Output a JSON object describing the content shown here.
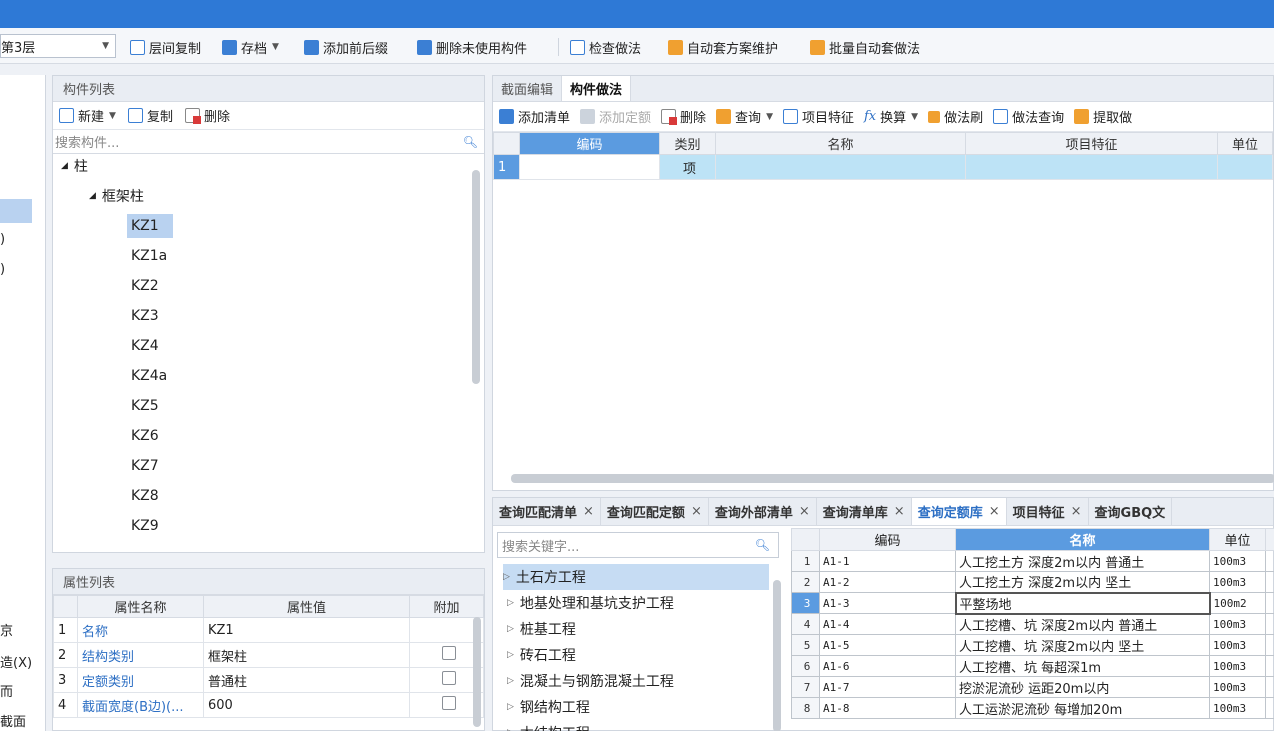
{
  "toolbar": {
    "floor": "第3层",
    "items": [
      "层间复制",
      "存档",
      "添加前后缀",
      "删除未使用构件",
      "检查做法",
      "自动套方案维护",
      "批量自动套做法"
    ]
  },
  "left_strip": {
    "labels": [
      ")",
      ")",
      "京",
      "造(X)",
      "而",
      "截面"
    ]
  },
  "component_list": {
    "title": "构件列表",
    "tools": [
      "新建",
      "复制",
      "删除"
    ],
    "search_placeholder": "搜索构件...",
    "tree": {
      "root": "柱",
      "group": "框架柱",
      "items": [
        "KZ1",
        "KZ1a",
        "KZ2",
        "KZ3",
        "KZ4",
        "KZ4a",
        "KZ5",
        "KZ6",
        "KZ7",
        "KZ8",
        "KZ9"
      ]
    }
  },
  "property_list": {
    "title": "属性列表",
    "headers": [
      "属性名称",
      "属性值",
      "附加"
    ],
    "rows": [
      {
        "num": "1",
        "name": "名称",
        "value": "KZ1"
      },
      {
        "num": "2",
        "name": "结构类别",
        "value": "框架柱"
      },
      {
        "num": "3",
        "name": "定额类别",
        "value": "普通柱"
      },
      {
        "num": "4",
        "name": "截面宽度(B边)(...",
        "value": "600"
      }
    ]
  },
  "right_tabs": [
    "截面编辑",
    "构件做法"
  ],
  "right_tools": [
    "添加清单",
    "添加定额",
    "删除",
    "查询",
    "项目特征",
    "换算",
    "做法刷",
    "做法查询",
    "提取做"
  ],
  "main_grid": {
    "headers": [
      "编码",
      "类别",
      "名称",
      "项目特征",
      "单位"
    ],
    "rows": [
      {
        "num": "1",
        "code": "",
        "type": "项",
        "name": "",
        "feature": "",
        "unit": ""
      }
    ]
  },
  "bottom_tabs": [
    "查询匹配清单",
    "查询匹配定额",
    "查询外部清单",
    "查询清单库",
    "查询定额库",
    "项目特征",
    "查询GBQ文"
  ],
  "quota_search_placeholder": "搜索关键字...",
  "categories": [
    "土石方工程",
    "地基处理和基坑支护工程",
    "桩基工程",
    "砖石工程",
    "混凝土与钢筋混凝土工程",
    "钢结构工程",
    "木结构工程"
  ],
  "quota_table": {
    "headers": [
      "编码",
      "名称",
      "单位"
    ],
    "rows": [
      {
        "num": "1",
        "code": "A1-1",
        "name": "人工挖土方 深度2m以内 普通土",
        "unit": "100m3"
      },
      {
        "num": "2",
        "code": "A1-2",
        "name": "人工挖土方 深度2m以内 坚土",
        "unit": "100m3"
      },
      {
        "num": "3",
        "code": "A1-3",
        "name": "平整场地",
        "unit": "100m2"
      },
      {
        "num": "4",
        "code": "A1-4",
        "name": "人工挖槽、坑 深度2m以内 普通土",
        "unit": "100m3"
      },
      {
        "num": "5",
        "code": "A1-5",
        "name": "人工挖槽、坑 深度2m以内 坚土",
        "unit": "100m3"
      },
      {
        "num": "6",
        "code": "A1-6",
        "name": "人工挖槽、坑 每超深1m",
        "unit": "100m3"
      },
      {
        "num": "7",
        "code": "A1-7",
        "name": "挖淤泥流砂 运距20m以内",
        "unit": "100m3"
      },
      {
        "num": "8",
        "code": "A1-8",
        "name": "人工运淤泥流砂 每增加20m",
        "unit": "100m3"
      }
    ]
  }
}
